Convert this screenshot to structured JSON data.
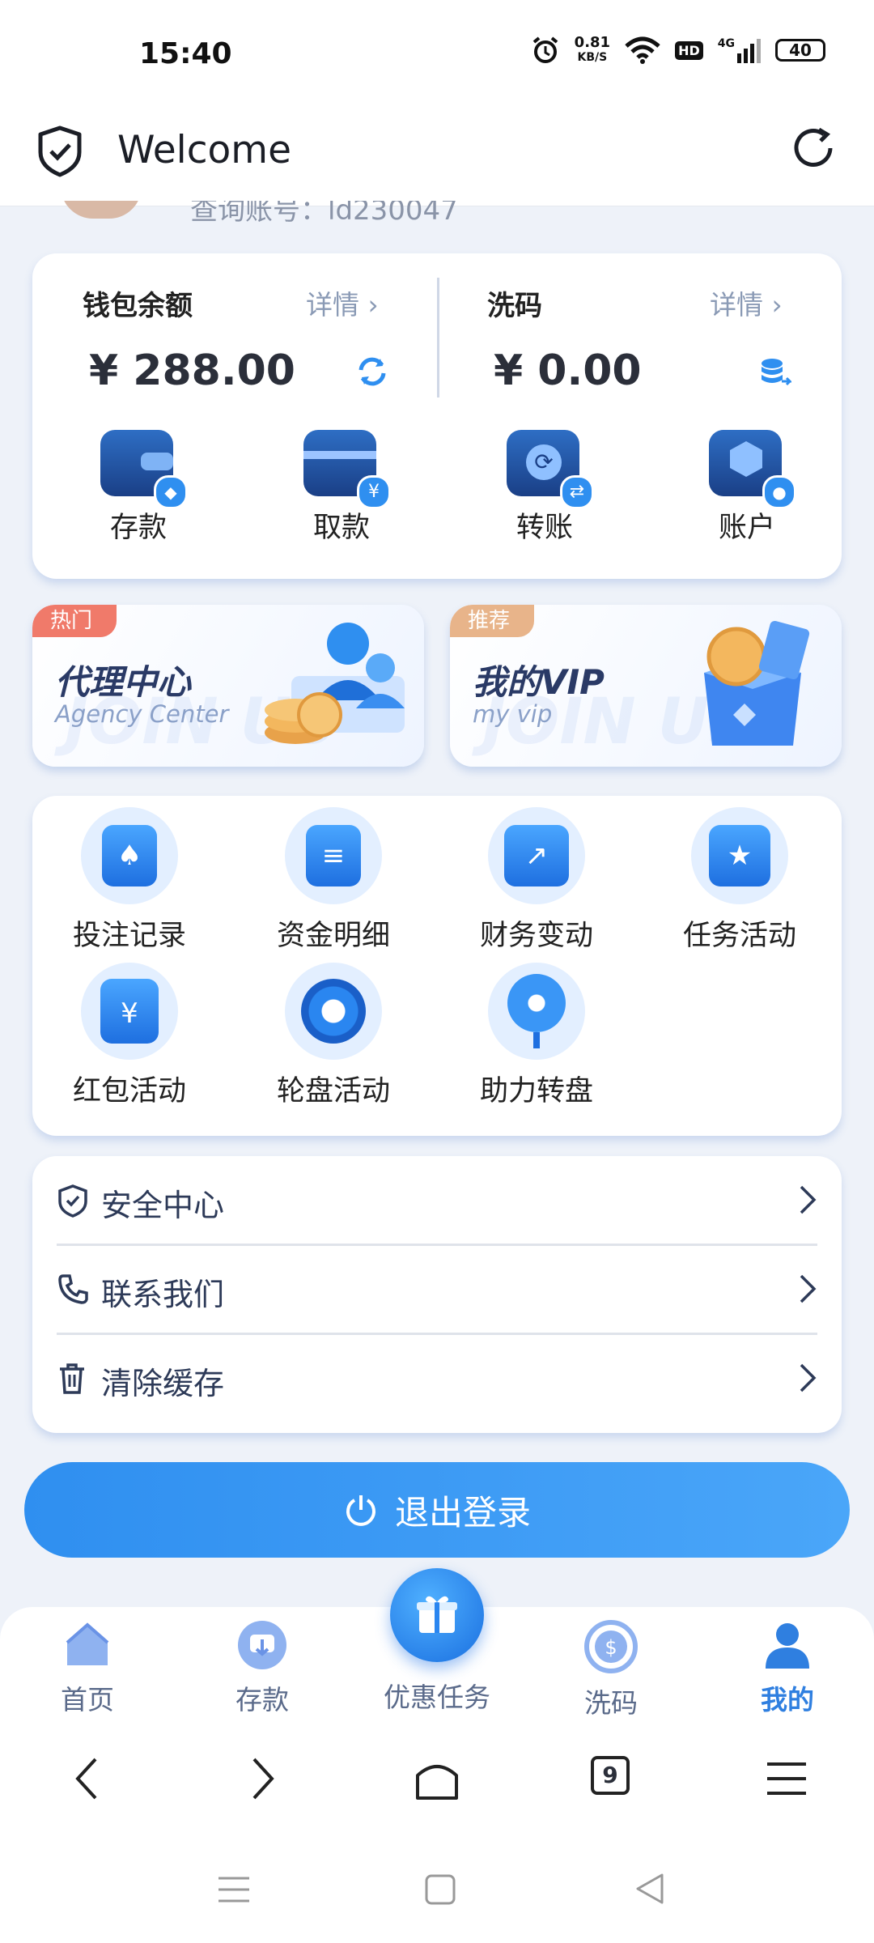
{
  "status": {
    "time": "15:40",
    "speed_value": "0.81",
    "speed_unit": "KB/S",
    "hd": "HD",
    "network": "4G",
    "battery": "40"
  },
  "header": {
    "title": "Welcome",
    "left_icon": "shield-check-icon",
    "right_icon": "refresh-icon"
  },
  "user_partial": {
    "label": "查询账号：",
    "value": "ld230047"
  },
  "wallet": {
    "balance_label": "钱包余额",
    "balance_detail": "详情",
    "balance_amount": "¥ 288.00",
    "wash_label": "洗码",
    "wash_detail": "详情",
    "wash_amount": "¥ 0.00",
    "actions": [
      {
        "label": "存款",
        "icon": "wallet-deposit-icon"
      },
      {
        "label": "取款",
        "icon": "card-withdraw-icon"
      },
      {
        "label": "转账",
        "icon": "transfer-icon"
      },
      {
        "label": "账户",
        "icon": "account-icon"
      }
    ]
  },
  "promos": [
    {
      "tag": "热门",
      "title": "代理中心",
      "subtitle": "Agency Center",
      "bg_text": "JOIN US",
      "tag_color": "#f07a6a"
    },
    {
      "tag": "推荐",
      "title": "我的VIP",
      "subtitle": "my vip",
      "bg_text": "JOIN US",
      "tag_color": "#e8b48a"
    }
  ],
  "features": [
    {
      "label": "投注记录",
      "icon": "bet-record-icon"
    },
    {
      "label": "资金明细",
      "icon": "funds-detail-icon"
    },
    {
      "label": "财务变动",
      "icon": "finance-change-icon"
    },
    {
      "label": "任务活动",
      "icon": "task-activity-icon"
    },
    {
      "label": "红包活动",
      "icon": "red-packet-icon"
    },
    {
      "label": "轮盘活动",
      "icon": "roulette-icon"
    },
    {
      "label": "助力转盘",
      "icon": "boost-wheel-icon"
    }
  ],
  "menu": [
    {
      "label": "安全中心",
      "icon": "shield-icon"
    },
    {
      "label": "联系我们",
      "icon": "phone-icon"
    },
    {
      "label": "清除缓存",
      "icon": "trash-icon"
    }
  ],
  "logout": {
    "label": "退出登录"
  },
  "tabs": [
    {
      "label": "首页",
      "icon": "home-icon"
    },
    {
      "label": "存款",
      "icon": "deposit-icon"
    },
    {
      "label": "优惠任务",
      "icon": "gift-icon"
    },
    {
      "label": "洗码",
      "icon": "wash-code-icon"
    },
    {
      "label": "我的",
      "icon": "profile-icon"
    }
  ],
  "browser": {
    "tab_count": "9"
  },
  "colors": {
    "accent": "#2f8ff0",
    "active_tab": "#2f7fe0"
  }
}
